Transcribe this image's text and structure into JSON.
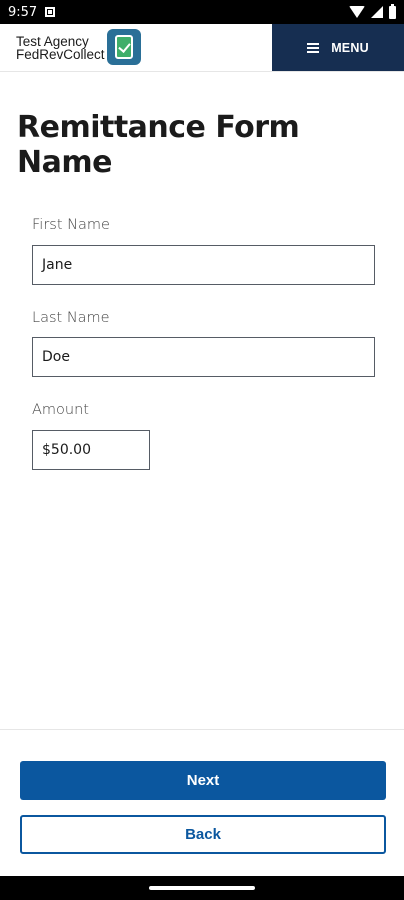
{
  "status_bar": {
    "time": "9:57",
    "icons": [
      "notification-icon",
      "wifi-icon",
      "signal-icon",
      "battery-icon"
    ]
  },
  "header": {
    "brand_line1": "Test Agency",
    "brand_line2": "FedRevCollect",
    "menu_label": "MENU",
    "menu_color": "#162e51"
  },
  "page": {
    "title": "Remittance Form Name"
  },
  "form": {
    "first_name": {
      "label": "First Name",
      "value": "Jane"
    },
    "last_name": {
      "label": "Last Name",
      "value": "Doe"
    },
    "amount": {
      "label": "Amount",
      "value": "$50.00"
    }
  },
  "actions": {
    "next_label": "Next",
    "back_label": "Back",
    "primary_color": "#0b579f"
  }
}
